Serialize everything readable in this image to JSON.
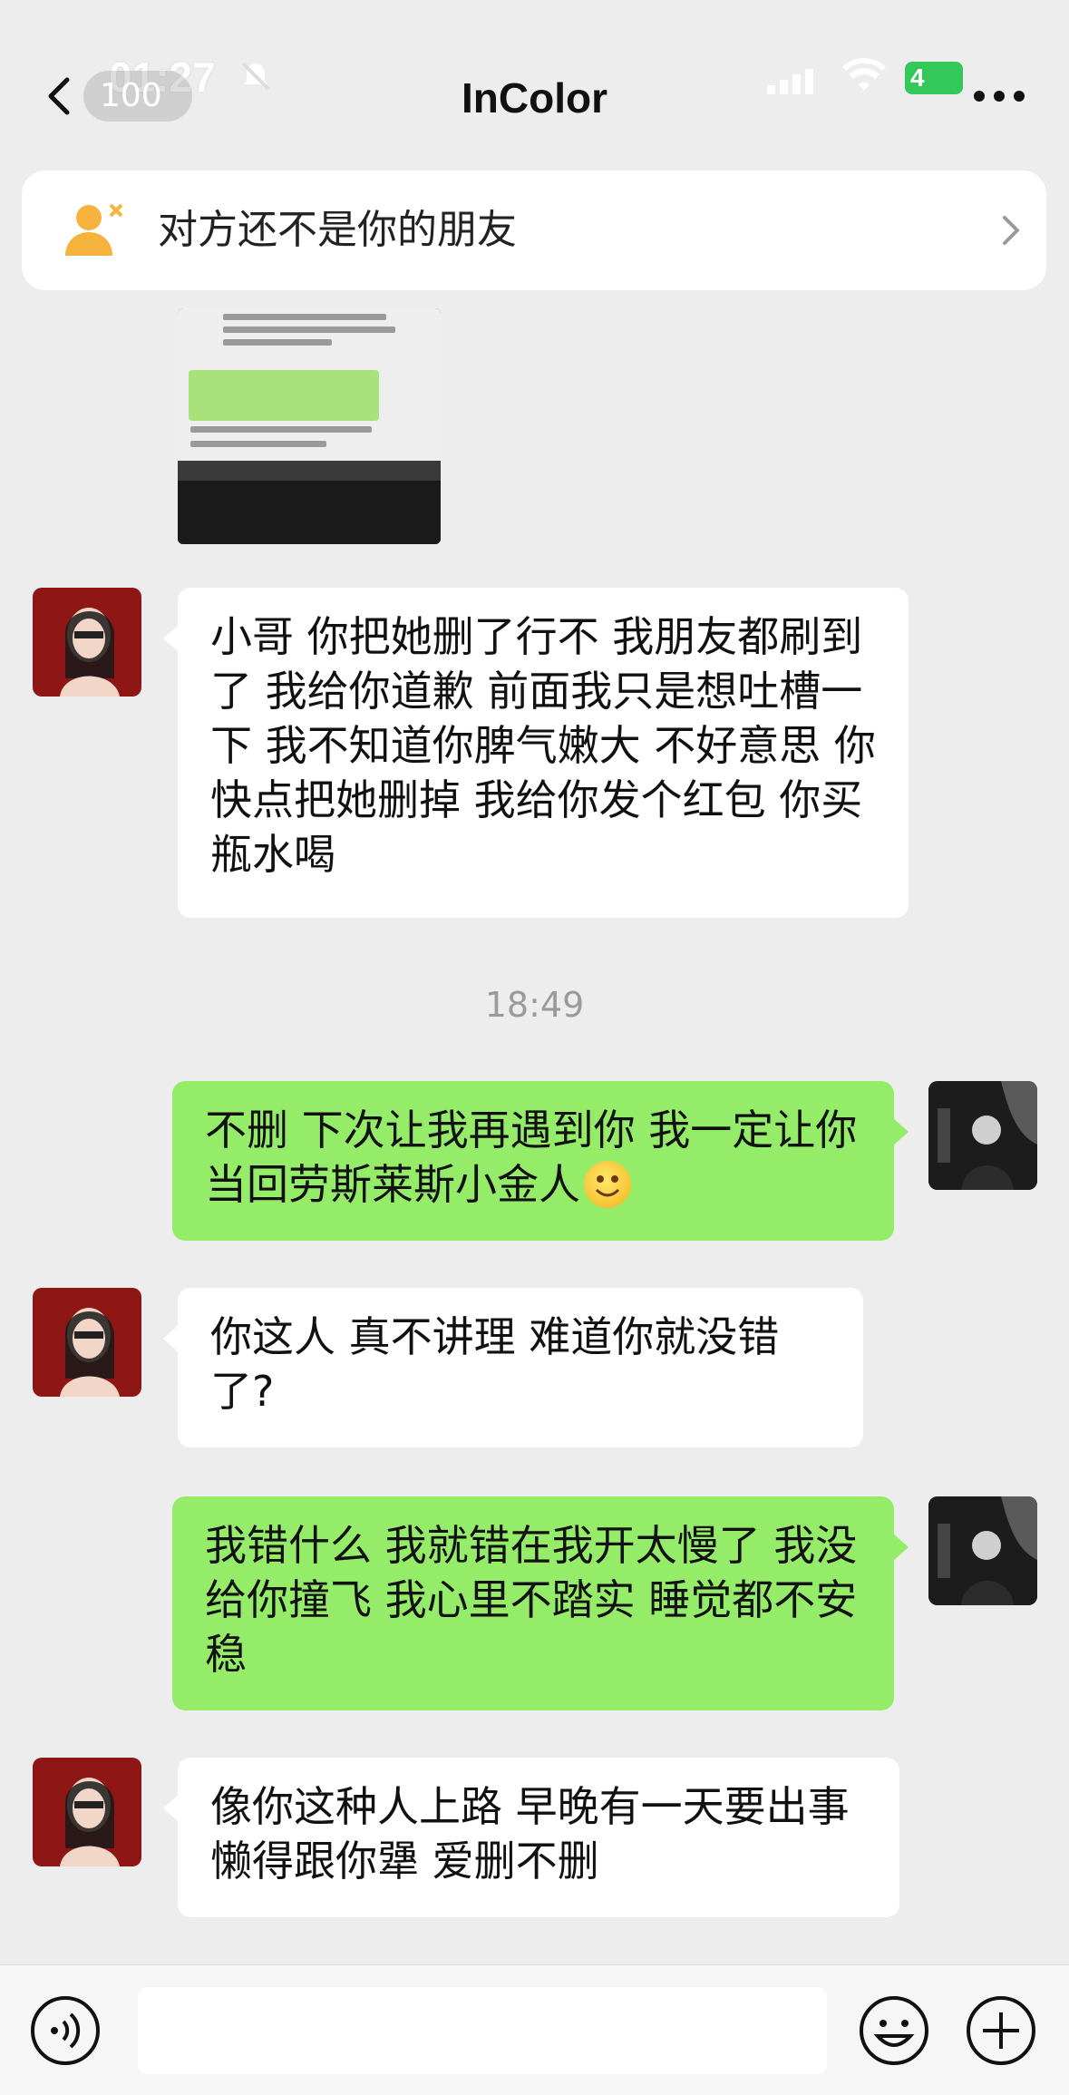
{
  "status_bar": {
    "time": "01:27",
    "battery": "4"
  },
  "nav": {
    "unread_count": "100",
    "title": "InColor"
  },
  "notice": {
    "text": "对方还不是你的朋友"
  },
  "timestamp": "18:49",
  "messages": [
    {
      "side": "in",
      "text": "小哥 你把她删了行不 我朋友都刷到了 我给你道歉 前面我只是想吐槽一下 我不知道你脾气嫩大 不好意思 你快点把她删掉 我给你发个红包 你买瓶水喝"
    },
    {
      "side": "out",
      "text": "不删 下次让我再遇到你 我一定让你当回劳斯莱斯小金人",
      "emoji": "smiley-emoji"
    },
    {
      "side": "in",
      "text": "你这人 真不讲理 难道你就没错了?"
    },
    {
      "side": "out",
      "text": "我错什么 我就错在我开太慢了 我没给你撞飞 我心里不踏实 睡觉都不安稳"
    },
    {
      "side": "in",
      "text": "像你这种人上路 早晚有一天要出事 懒得跟你犟 爱删不删"
    }
  ],
  "icons": {
    "back": "back-arrow-icon",
    "more": "more-dots-icon",
    "notice": "user-not-friend-icon",
    "voice": "voice-icon",
    "emoji": "emoji-icon",
    "plus": "plus-icon"
  },
  "colors": {
    "outgoing_bubble": "#95ec69",
    "incoming_bubble": "#ffffff",
    "background": "#ededed",
    "notice_icon": "#f5b23d"
  }
}
